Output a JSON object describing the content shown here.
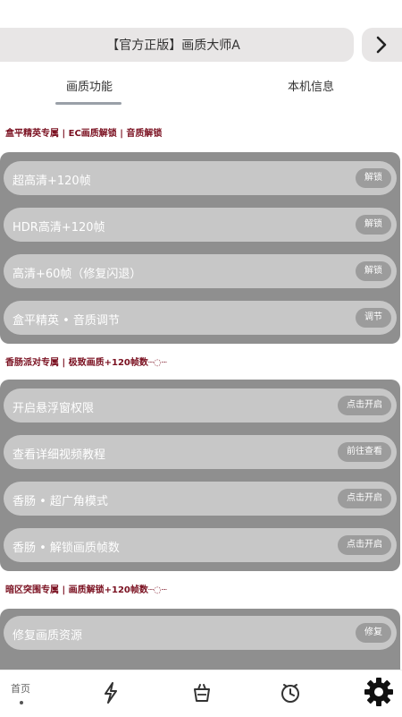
{
  "header": {
    "title": "【官方正版】画质大师A"
  },
  "tabs": [
    {
      "label": "画质功能"
    },
    {
      "label": "本机信息"
    }
  ],
  "sections": [
    {
      "title": "盒平精英专属 | EC画质解锁 | 音质解锁",
      "items": [
        {
          "label": "超高清+120帧",
          "button": "解锁"
        },
        {
          "label": "HDR高清+120帧",
          "button": "解锁"
        },
        {
          "label": "高清+60帧（修复闪退）",
          "button": "解锁"
        },
        {
          "label": "盒平精英 • 音质调节",
          "button": "调节"
        }
      ]
    },
    {
      "title": "香肠派对专属 | 极致画质+120帧数┈◌┈",
      "items": [
        {
          "label": "开启悬浮窗权限",
          "button": "点击开启"
        },
        {
          "label": "查看详细视频教程",
          "button": "前往查看"
        },
        {
          "label": "香肠 • 超广角模式",
          "button": "点击开启"
        },
        {
          "label": "香肠 • 解锁画质帧数",
          "button": "点击开启"
        }
      ]
    },
    {
      "title": "暗区突围专属 | 画质解锁+120帧数┈◌┈",
      "items": [
        {
          "label": "修复画质资源",
          "button": "修复"
        }
      ]
    }
  ],
  "bottom_nav": {
    "home_label": "首页"
  },
  "icons": [
    "chevron-right-icon",
    "lightning-icon",
    "basket-icon",
    "clock-icon",
    "gear-icon"
  ]
}
